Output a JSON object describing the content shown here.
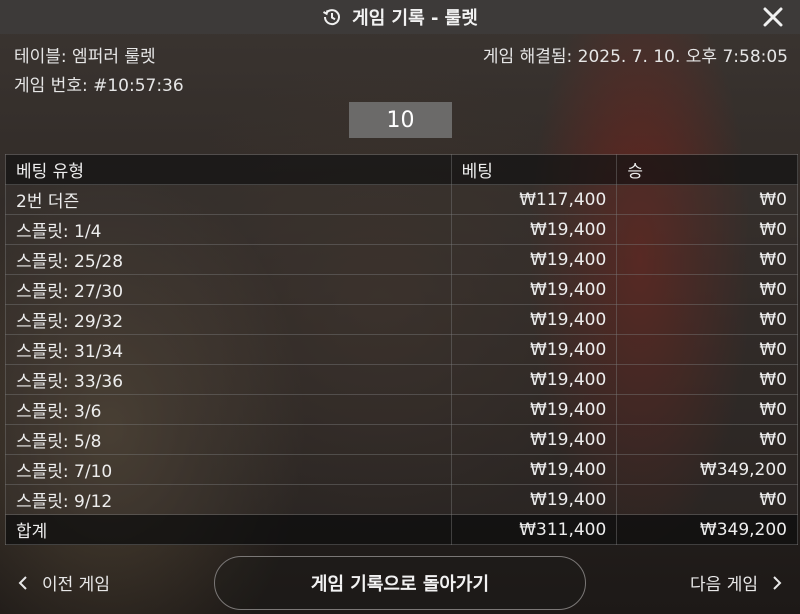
{
  "header": {
    "title": "게임 기록 - 룰렛"
  },
  "info": {
    "table": "테이블: 엠퍼러 룰렛",
    "game_number": "게임 번호: #10:57:36",
    "resolved": "게임 해결됨: 2025. 7. 10. 오후 7:58:05"
  },
  "result": "10",
  "bets_table": {
    "headers": [
      "베팅 유형",
      "베팅",
      "승"
    ],
    "rows": [
      {
        "type": "2번 더즌",
        "bet": "₩117,400",
        "win": "₩0"
      },
      {
        "type": "스플릿: 1/4",
        "bet": "₩19,400",
        "win": "₩0"
      },
      {
        "type": "스플릿: 25/28",
        "bet": "₩19,400",
        "win": "₩0"
      },
      {
        "type": "스플릿: 27/30",
        "bet": "₩19,400",
        "win": "₩0"
      },
      {
        "type": "스플릿: 29/32",
        "bet": "₩19,400",
        "win": "₩0"
      },
      {
        "type": "스플릿: 31/34",
        "bet": "₩19,400",
        "win": "₩0"
      },
      {
        "type": "스플릿: 33/36",
        "bet": "₩19,400",
        "win": "₩0"
      },
      {
        "type": "스플릿: 3/6",
        "bet": "₩19,400",
        "win": "₩0"
      },
      {
        "type": "스플릿: 5/8",
        "bet": "₩19,400",
        "win": "₩0"
      },
      {
        "type": "스플릿: 7/10",
        "bet": "₩19,400",
        "win": "₩349,200"
      },
      {
        "type": "스플릿: 9/12",
        "bet": "₩19,400",
        "win": "₩0"
      }
    ],
    "total": {
      "label": "합계",
      "bet": "₩311,400",
      "win": "₩349,200"
    }
  },
  "footer": {
    "prev_label": "이전 게임",
    "back_label": "게임 기록으로 돌아가기",
    "next_label": "다음 게임"
  },
  "icons": {
    "header": "history-icon",
    "close": "close-icon",
    "prev": "chevron-left-icon",
    "next": "chevron-right-icon"
  }
}
